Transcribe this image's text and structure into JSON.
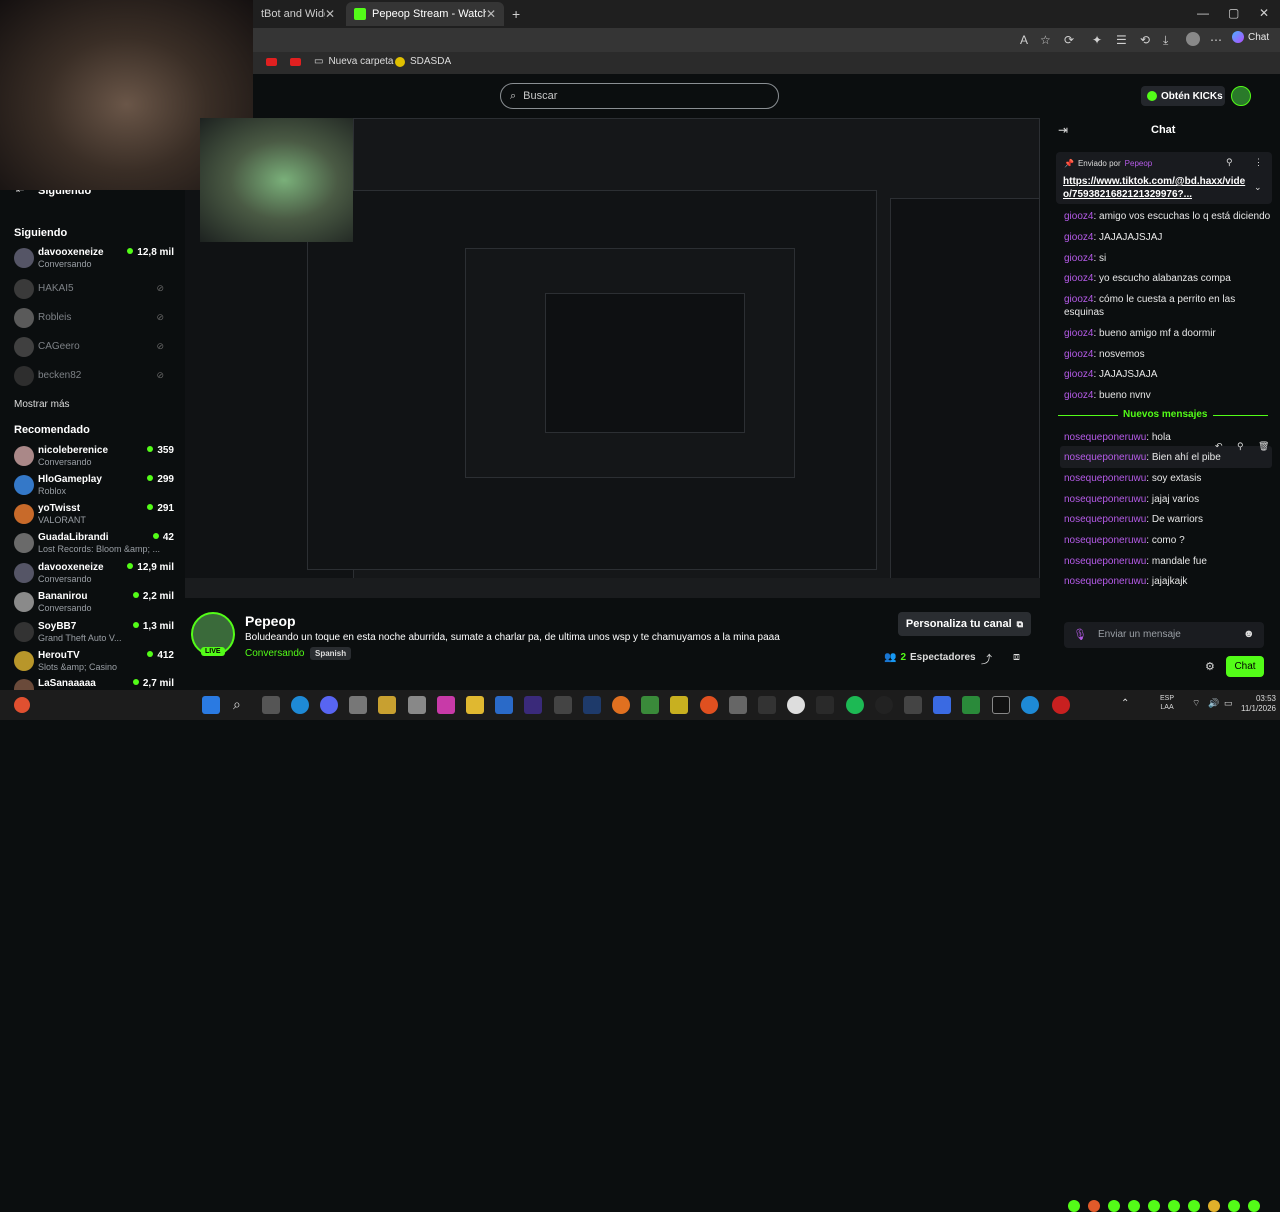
{
  "browser": {
    "tabs": [
      {
        "title": "tBot and Widgets for",
        "active": false
      },
      {
        "title": "Pepeop Stream - Watch Live on K",
        "active": true
      }
    ],
    "bookmarks": [
      {
        "label": "Nueva carpeta",
        "icon": "folder-icon"
      },
      {
        "label": "SDASDA",
        "icon": "smiley-icon"
      }
    ],
    "profile_chip": "Chat"
  },
  "header": {
    "search_placeholder": "Buscar",
    "kicks_button": "Obtén KICKs"
  },
  "sidebar": {
    "title": "Siguiendo",
    "following_heading": "Siguiendo",
    "following": [
      {
        "name": "davooxeneize",
        "status": "Conversando",
        "viewers": "12,8 mil",
        "online": true
      },
      {
        "name": "HAKAI5",
        "status": "",
        "viewers": "",
        "online": false
      },
      {
        "name": "Robleis",
        "status": "",
        "viewers": "",
        "online": false
      },
      {
        "name": "CAGeero",
        "status": "",
        "viewers": "",
        "online": false
      },
      {
        "name": "becken82",
        "status": "",
        "viewers": "",
        "online": false
      }
    ],
    "show_more": "Mostrar más",
    "recommended_heading": "Recomendado",
    "recommended": [
      {
        "name": "nicoleberenice",
        "status": "Conversando",
        "viewers": "359"
      },
      {
        "name": "HloGameplay",
        "status": "Roblox",
        "viewers": "299"
      },
      {
        "name": "yoTwisst",
        "status": "VALORANT",
        "viewers": "291"
      },
      {
        "name": "GuadaLibrandi",
        "status": "Lost Records: Bloom &amp; ...",
        "viewers": "42"
      },
      {
        "name": "davooxeneize",
        "status": "Conversando",
        "viewers": "12,9 mil"
      },
      {
        "name": "Bananirou",
        "status": "Conversando",
        "viewers": "2,2 mil"
      },
      {
        "name": "SoyBB7",
        "status": "Grand Theft Auto V...",
        "viewers": "1,3 mil"
      },
      {
        "name": "HerouTV",
        "status": "Slots &amp; Casino",
        "viewers": "412"
      },
      {
        "name": "LaSanaaaaa",
        "status": "",
        "viewers": "2,7 mil"
      }
    ]
  },
  "stream": {
    "streamer": "Pepeop",
    "live_badge": "LIVE",
    "title": "Boludeando un toque en esta noche aburrida, sumate a charlar pa, de ultima unos wsp y te chamuyamos a la mina paaa",
    "category": "Conversando",
    "language": "Spanish",
    "customize_button": "Personaliza tu canal",
    "viewers_count": "2",
    "viewers_label": "Espectadores"
  },
  "chat": {
    "title": "Chat",
    "pinned_prefix": "Enviado por",
    "pinned_user": "Pepeop",
    "pinned_link": "https://www.tiktok.com/@bd.haxx/video/7593821682121329976?...",
    "pinned_link_line1": "https://www.tiktok.com/@bd.haxx/vide",
    "pinned_link_line2": "o/7593821682121329976?...",
    "messages": [
      {
        "user": "giooz4",
        "text": "amigo vos escuchas lo q está diciendo"
      },
      {
        "user": "giooz4",
        "text": "JAJAJAJSJAJ"
      },
      {
        "user": "giooz4",
        "text": "si"
      },
      {
        "user": "giooz4",
        "text": "yo escucho alabanzas compa"
      },
      {
        "user": "giooz4",
        "text": "cómo le cuesta a perrito en las"
      },
      {
        "user": "",
        "text": "esquinas"
      },
      {
        "user": "giooz4",
        "text": "bueno amigo mf a doormir"
      },
      {
        "user": "giooz4",
        "text": "nosvemos"
      },
      {
        "user": "giooz4",
        "text": "JAJAJSJAJA"
      },
      {
        "user": "giooz4",
        "text": "bueno nvnv"
      }
    ],
    "new_messages_label": "Nuevos mensajes",
    "new_messages": [
      {
        "user": "nosequeponeruwu",
        "text": "hola"
      },
      {
        "user": "nosequeponeruwu",
        "text": "Bien ahí el pibe"
      },
      {
        "user": "nosequeponeruwu",
        "text": "soy extasis"
      },
      {
        "user": "nosequeponeruwu",
        "text": "jajaj varios"
      },
      {
        "user": "nosequeponeruwu",
        "text": "De warriors"
      },
      {
        "user": "nosequeponeruwu",
        "text": "como ?"
      },
      {
        "user": "nosequeponeruwu",
        "text": "mandale fue"
      },
      {
        "user": "nosequeponeruwu",
        "text": "jajajkajk"
      }
    ],
    "input_placeholder": "Enviar un mensaje",
    "send_button": "Chat"
  },
  "taskbar": {
    "lang_top": "ESP",
    "lang_bottom": "LAA",
    "time": "03:53",
    "date": "11/1/2026"
  },
  "colors": {
    "kick_green": "#53fc18",
    "chat_user": "#b55be8",
    "background": "#0b0e0f"
  }
}
